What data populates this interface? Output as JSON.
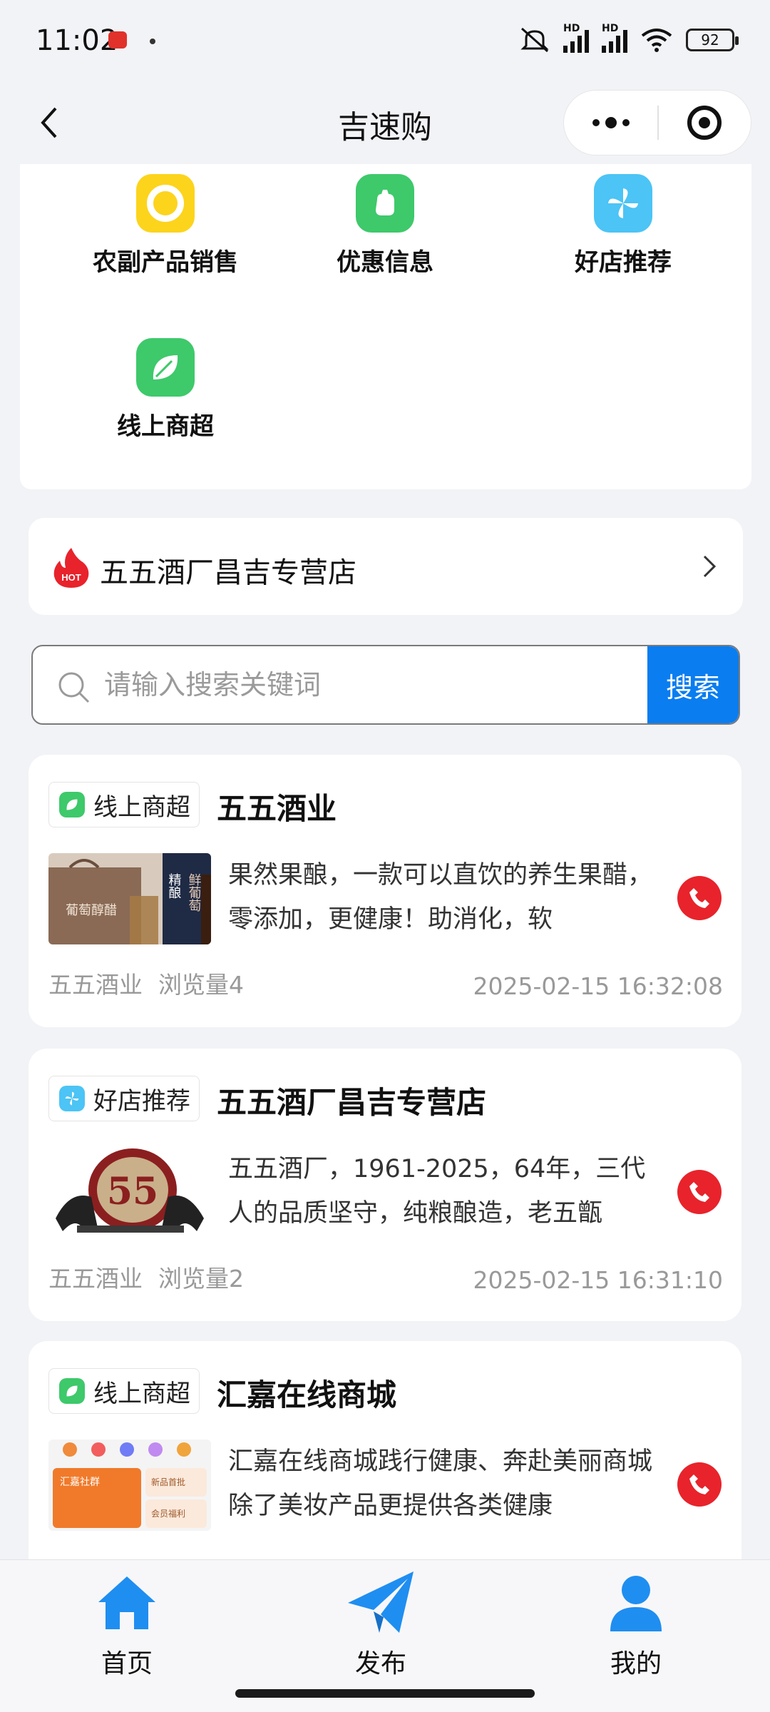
{
  "status_bar": {
    "time": "11:02",
    "network_label": "HD",
    "battery": "92"
  },
  "nav": {
    "title": "吉速购",
    "icons": {
      "back": "chevron-left-icon",
      "more": "more-dots-icon",
      "close": "target-icon"
    }
  },
  "categories": [
    {
      "label": "农副产品销售",
      "icon": "ring-icon",
      "color": "#fcd41c"
    },
    {
      "label": "优惠信息",
      "icon": "coupon-blob-icon",
      "color": "#3ec96b"
    },
    {
      "label": "好店推荐",
      "icon": "pinwheel-icon",
      "color": "#4cc4f5"
    },
    {
      "label": "线上商超",
      "icon": "leaf-icon",
      "color": "#3ec96b"
    }
  ],
  "hot_store": {
    "badge": "HOT",
    "name": "五五酒厂昌吉专营店"
  },
  "search": {
    "placeholder": "请输入搜索关键词",
    "button": "搜索"
  },
  "posts": [
    {
      "tag": "线上商超",
      "title": "五五酒业",
      "desc": "果然果酿，一款可以直饮的养生果醋，零添加，更健康！助消化，软",
      "author": "五五酒业",
      "views": "浏览量4",
      "date": "2025-02-15 16:32:08"
    },
    {
      "tag": "好店推荐",
      "title": "五五酒厂昌吉专营店",
      "desc": "五五酒厂，1961-2025，64年，三代人的品质坚守，纯粮酿造，老五甑",
      "author": "五五酒业",
      "views": "浏览量2",
      "date": "2025-02-15 16:31:10"
    },
    {
      "tag": "线上商超",
      "title": "汇嘉在线商城",
      "desc": "汇嘉在线商城践行健康、奔赴美丽商城除了美妆产品更提供各类健康",
      "author": "",
      "views": "",
      "date": ""
    }
  ],
  "thumb_text": {
    "post1_label_a": "精酿",
    "post1_label_b": "鲜葡萄",
    "post1_label_c": "葡萄醇醋",
    "post2_number": "55",
    "post3_title": "汇嘉社群",
    "post3_item1": "新品首批",
    "post3_item2": "会员福利"
  },
  "tabs": [
    {
      "label": "首页",
      "icon": "home-icon"
    },
    {
      "label": "发布",
      "icon": "paper-plane-icon"
    },
    {
      "label": "我的",
      "icon": "user-icon"
    }
  ],
  "colors": {
    "accent": "#0a7df0",
    "phone": "#e8232b",
    "tab_icon": "#1f8ef1"
  }
}
